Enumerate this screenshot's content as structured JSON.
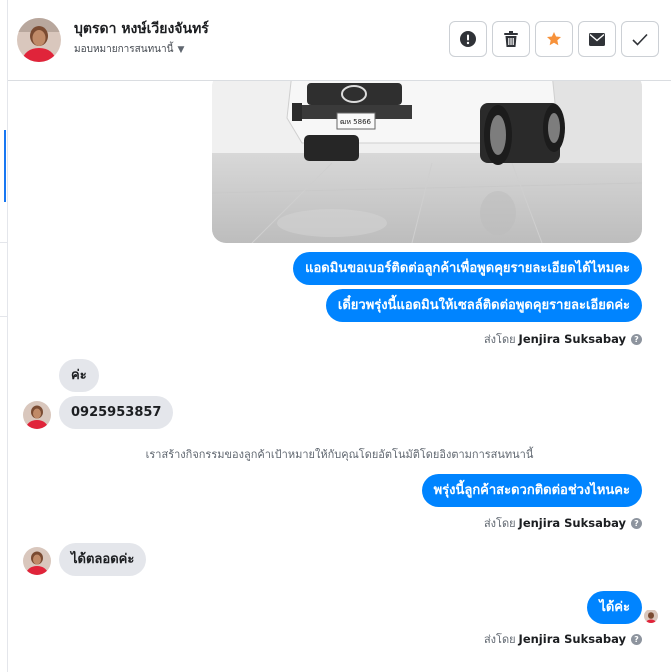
{
  "header": {
    "contact_name": "บุตรดา หงษ์เวียงจันทร์",
    "assign_label": "มอบหมายการสนทนานี้"
  },
  "actions": [
    {
      "icon": "alert-icon"
    },
    {
      "icon": "trash-icon"
    },
    {
      "icon": "star-icon"
    },
    {
      "icon": "mail-icon"
    },
    {
      "icon": "check-icon"
    }
  ],
  "colors": {
    "accent": "#1877f2",
    "bubble_out": "#0084ff",
    "bubble_in": "#e4e6eb",
    "star": "#f7923b"
  },
  "photo": {
    "plate": "ฒห 5866"
  },
  "messages": {
    "out1": "แอดมินขอเบอร์ติดต่อลูกค้าเพื่อพูดคุยรายละเอียดได้ไหมคะ",
    "out2": "เดี๋ยวพรุ่งนี้แอดมินให้เซลล์ติดต่อพูดคุยรายละเอียดค่ะ",
    "in1": "ค่ะ",
    "in2": "0925953857",
    "system": "เราสร้างกิจกรรมของลูกค้าเป้าหมายให้กับคุณโดยอัตโนมัติโดยอิงตามการสนทนานี้",
    "out3": "พรุ่งนี้ลูกค้าสะดวกติดต่อช่วงไหนคะ",
    "in3": "ได้ตลอดค่ะ",
    "out4": "ได้ค่ะ"
  },
  "sent_by": {
    "prefix": "ส่งโดย",
    "name": "Jenjira Suksabay",
    "help": "?"
  }
}
